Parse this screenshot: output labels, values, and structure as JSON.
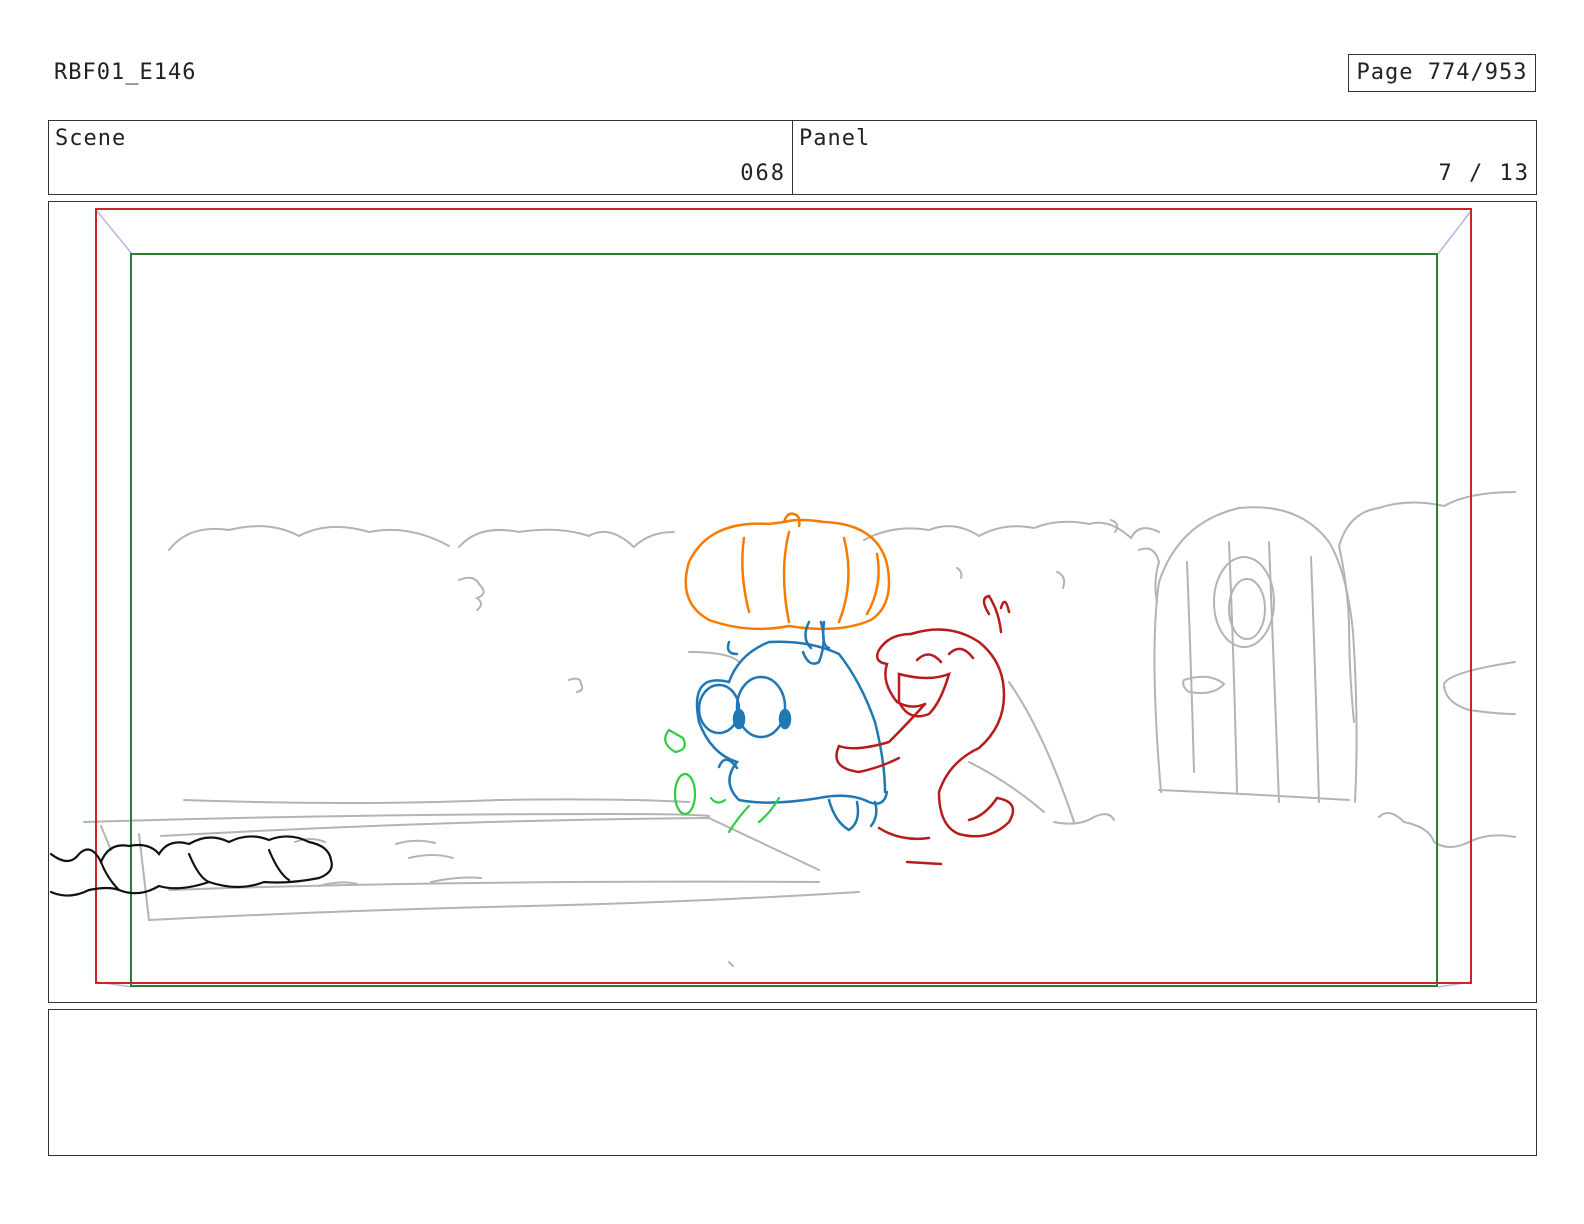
{
  "header": {
    "doc_id": "RBF01_E146",
    "page_label": "Page 774/953"
  },
  "info": {
    "scene_label": "Scene",
    "scene_value": "068",
    "panel_label": "Panel",
    "panel_value": "7 / 13"
  },
  "notes": {
    "text": ""
  },
  "colors": {
    "safe_action_frame": "#c62828",
    "title_safe_frame": "#2e7d32",
    "pumpkin": "#f57c00",
    "character_blue": "#1f77b4",
    "character_red": "#b71c1c",
    "character_green": "#2ecc40",
    "background_sketch": "#b0b0b0"
  }
}
